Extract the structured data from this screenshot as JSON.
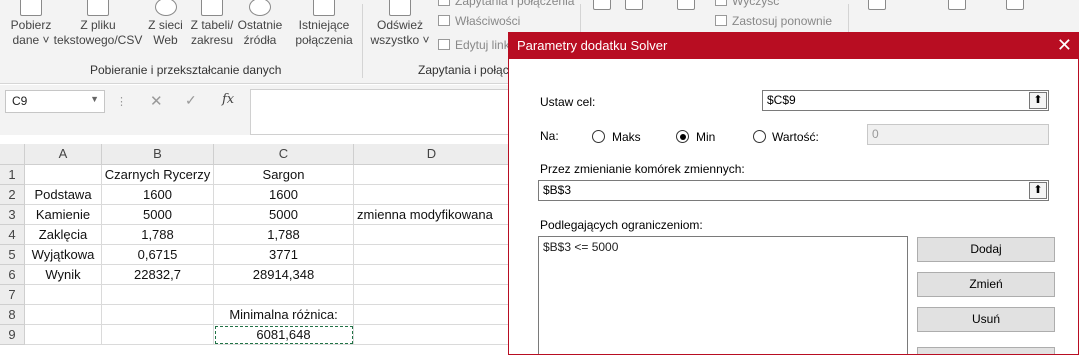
{
  "ribbon": {
    "buttons": [
      {
        "line1": "Pobierz",
        "line2": "dane ˅"
      },
      {
        "line1": "Z pliku",
        "line2": "tekstowego/CSV"
      },
      {
        "line1": "Z sieci",
        "line2": "Web"
      },
      {
        "line1": "Z tabeli/",
        "line2": "zakresu"
      },
      {
        "line1": "Ostatnie",
        "line2": "źródła"
      },
      {
        "line1": "Istniejące",
        "line2": "połączenia"
      },
      {
        "line1": "Odśwież",
        "line2": "wszystko ˅"
      }
    ],
    "small_items": [
      "Zapytania i połączenia",
      "Właściwości",
      "Edytuj linki"
    ],
    "sort_items": [
      "Wyczyść",
      "Zastosuj ponownie"
    ],
    "group_labels": [
      "Pobieranie i przekształcanie danych",
      "Zapytania i połącz"
    ]
  },
  "formula_bar": {
    "name_box": "C9",
    "cancel_symbol": "✕",
    "enter_symbol": "✓",
    "fx_label": "fx",
    "formula": ""
  },
  "sheet": {
    "columns": [
      "A",
      "B",
      "C",
      "D"
    ],
    "rows": [
      "1",
      "2",
      "3",
      "4",
      "5",
      "6",
      "7",
      "8",
      "9"
    ],
    "cells": {
      "B1": "Czarnych Rycerzy",
      "C1": "Sargon",
      "A2": "Podstawa",
      "B2": "1600",
      "C2": "1600",
      "A3": "Kamienie",
      "B3": "5000",
      "C3": "5000",
      "D3": "zmienna modyfikowana",
      "A4": "Zaklęcia",
      "B4": "1,788",
      "C4": "1,788",
      "A5": "Wyjątkowa",
      "B5": "0,6715",
      "C5": "3771",
      "A6": "Wynik",
      "B6": "22832,7",
      "C6": "28914,348",
      "C8": "Minimalna różnica:",
      "C9": "6081,648"
    }
  },
  "dialog": {
    "title": "Parametry dodatku Solver",
    "close_symbol": "✕",
    "set_objective_label": "Ustaw cel:",
    "set_objective_value": "$C$9",
    "to_label": "Na:",
    "options": {
      "max": "Maks",
      "min": "Min",
      "value_of": "Wartość:"
    },
    "selected_option": "min",
    "value_of_input": "0",
    "changing_cells_label": "Przez zmienianie komórek zmiennych:",
    "changing_cells_value": "$B$3",
    "constraints_label": "Podlegających ograniczeniom:",
    "constraints": [
      "$B$3 <= 5000"
    ],
    "buttons": {
      "add": "Dodaj",
      "change": "Zmień",
      "delete": "Usuń"
    },
    "picker_symbol": "⬆"
  },
  "colors": {
    "dialog_accent": "#b80d22",
    "selection_border": "#217346"
  }
}
